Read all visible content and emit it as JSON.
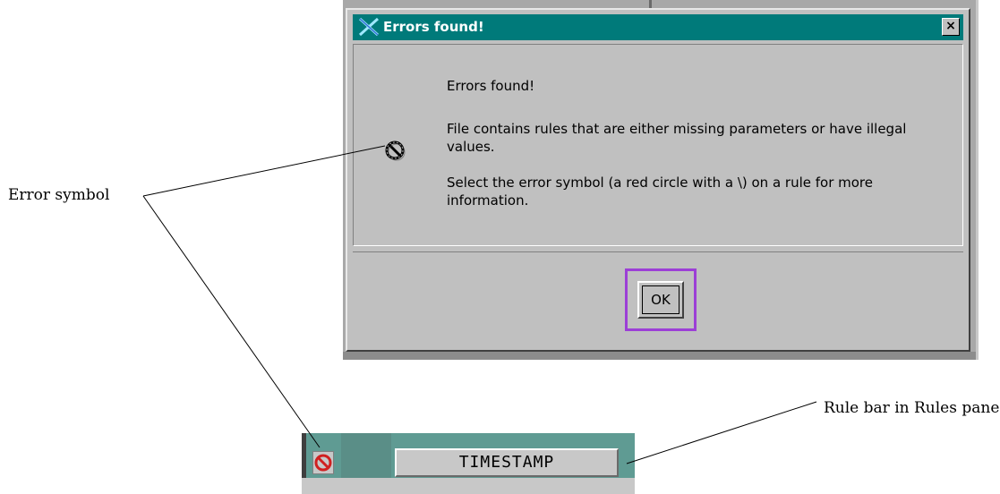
{
  "dialog": {
    "title": "Errors found!",
    "close_glyph": "×",
    "message_heading": "Errors found!",
    "message_body": "File contains rules that are either missing parameters or have illegal values.",
    "message_hint": "Select the error symbol (a red circle with a \\) on a rule for more information.",
    "ok_label": "OK",
    "icon": "error-symbol-icon",
    "highlight_color": "#9c3fd6"
  },
  "rule_bar": {
    "rule_name": "TIMESTAMP",
    "error_icon": "error-symbol-icon",
    "colors": {
      "bar": "#5f9b93",
      "error_red": "#d02020"
    }
  },
  "callouts": {
    "error_symbol": "Error symbol",
    "rule_bar": "Rule bar in Rules pane"
  },
  "colors": {
    "titlebar": "#007a7a",
    "dialog_bg": "#c0c0c0"
  }
}
